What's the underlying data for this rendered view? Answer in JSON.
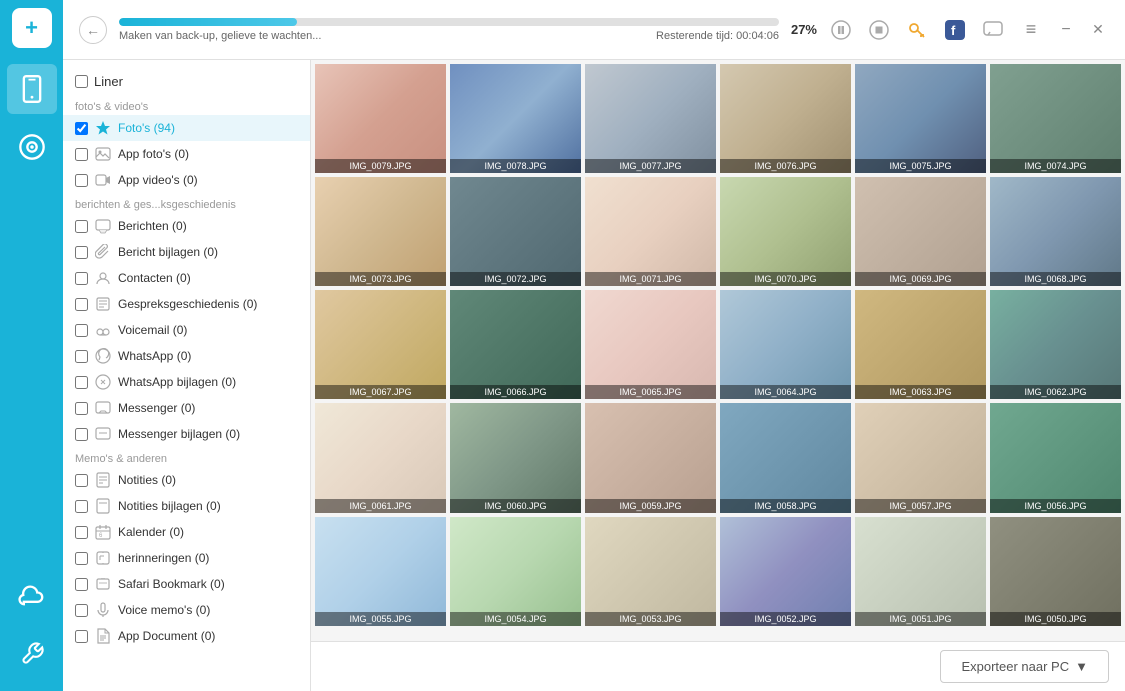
{
  "app": {
    "logo_symbol": "+",
    "accent_color": "#1ab3d8"
  },
  "topbar": {
    "progress_pct": 27,
    "progress_pct_label": "27%",
    "status_text": "Maken van back-up,  gelieve te wachten...",
    "remaining_label": "Resterende tijd: 00:04:06",
    "pause_icon": "⏸",
    "stop_icon": "⏺",
    "key_icon": "🔑",
    "facebook_icon": "f",
    "chat_icon": "💬",
    "menu_icon": "≡",
    "minimize_icon": "−",
    "close_icon": "✕"
  },
  "sidebar_nav": {
    "icons": [
      {
        "name": "phone-icon",
        "symbol": "📱"
      },
      {
        "name": "music-icon",
        "symbol": "🎵"
      },
      {
        "name": "cloud-icon",
        "symbol": "☁"
      },
      {
        "name": "tools-icon",
        "symbol": "🔧"
      }
    ]
  },
  "left_panel": {
    "header_label": "Liner",
    "sections": [
      {
        "label": "foto's & video's",
        "items": [
          {
            "id": "fotos",
            "label": "Foto's (94)",
            "active": true,
            "icon": "star-icon"
          },
          {
            "id": "appfotos",
            "label": "App foto's (0)",
            "active": false,
            "icon": "photo-icon"
          },
          {
            "id": "appvideos",
            "label": "App video's (0)",
            "active": false,
            "icon": "video-icon"
          }
        ]
      },
      {
        "label": "berichten & ges...ksgeschiedenis",
        "items": [
          {
            "id": "berichten",
            "label": "Berichten (0)",
            "active": false,
            "icon": "message-icon"
          },
          {
            "id": "berichtbijlagen",
            "label": "Bericht bijlagen (0)",
            "active": false,
            "icon": "attachment-icon"
          },
          {
            "id": "contacten",
            "label": "Contacten (0)",
            "active": false,
            "icon": "contacts-icon"
          },
          {
            "id": "gesprek",
            "label": "Gespreksgeschiedenis (0)",
            "active": false,
            "icon": "history-icon"
          },
          {
            "id": "voicemail",
            "label": "Voicemail (0)",
            "active": false,
            "icon": "voicemail-icon"
          },
          {
            "id": "whatsapp",
            "label": "WhatsApp (0)",
            "active": false,
            "icon": "whatsapp-icon"
          },
          {
            "id": "whatsappbijlagen",
            "label": "WhatsApp bijlagen (0)",
            "active": false,
            "icon": "whatsapp-attach-icon"
          },
          {
            "id": "messenger",
            "label": "Messenger (0)",
            "active": false,
            "icon": "messenger-icon"
          },
          {
            "id": "messengerbijlagen",
            "label": "Messenger bijlagen (0)",
            "active": false,
            "icon": "messenger-attach-icon"
          }
        ]
      },
      {
        "label": "Memo's & anderen",
        "items": [
          {
            "id": "notities",
            "label": "Notities (0)",
            "active": false,
            "icon": "notes-icon"
          },
          {
            "id": "notitiesbijlagen",
            "label": "Notities bijlagen (0)",
            "active": false,
            "icon": "notes-attach-icon"
          },
          {
            "id": "kalender",
            "label": "Kalender (0)",
            "active": false,
            "icon": "calendar-icon"
          },
          {
            "id": "herinneringen",
            "label": "herinneringen (0)",
            "active": false,
            "icon": "reminder-icon"
          },
          {
            "id": "safari",
            "label": "Safari Bookmark (0)",
            "active": false,
            "icon": "safari-icon"
          },
          {
            "id": "voicememos",
            "label": "Voice memo's (0)",
            "active": false,
            "icon": "voice-memo-icon"
          },
          {
            "id": "appdocument",
            "label": "App Document (0)",
            "active": false,
            "icon": "document-icon"
          }
        ]
      }
    ]
  },
  "photo_grid": {
    "photos": [
      {
        "label": "IMG_0079.JPG",
        "color_class": "c1"
      },
      {
        "label": "IMG_0078.JPG",
        "color_class": "c2"
      },
      {
        "label": "IMG_0077.JPG",
        "color_class": "c3"
      },
      {
        "label": "IMG_0076.JPG",
        "color_class": "c4"
      },
      {
        "label": "IMG_0075.JPG",
        "color_class": "c5"
      },
      {
        "label": "IMG_0074.JPG",
        "color_class": "c6"
      },
      {
        "label": "IMG_0073.JPG",
        "color_class": "c7"
      },
      {
        "label": "IMG_0072.JPG",
        "color_class": "c8"
      },
      {
        "label": "IMG_0071.JPG",
        "color_class": "c9"
      },
      {
        "label": "IMG_0070.JPG",
        "color_class": "c10"
      },
      {
        "label": "IMG_0069.JPG",
        "color_class": "c11"
      },
      {
        "label": "IMG_0068.JPG",
        "color_class": "c12"
      },
      {
        "label": "IMG_0067.JPG",
        "color_class": "c13"
      },
      {
        "label": "IMG_0066.JPG",
        "color_class": "c14"
      },
      {
        "label": "IMG_0065.JPG",
        "color_class": "c15"
      },
      {
        "label": "IMG_0064.JPG",
        "color_class": "c16"
      },
      {
        "label": "IMG_0063.JPG",
        "color_class": "c17"
      },
      {
        "label": "IMG_0062.JPG",
        "color_class": "c18"
      },
      {
        "label": "IMG_0061.JPG",
        "color_class": "c19"
      },
      {
        "label": "IMG_0060.JPG",
        "color_class": "c20"
      },
      {
        "label": "IMG_0059.JPG",
        "color_class": "c21"
      },
      {
        "label": "IMG_0058.JPG",
        "color_class": "c22"
      },
      {
        "label": "IMG_0057.JPG",
        "color_class": "c23"
      },
      {
        "label": "IMG_0056.JPG",
        "color_class": "c24"
      },
      {
        "label": "IMG_0055.JPG",
        "color_class": "c25"
      },
      {
        "label": "IMG_0054.JPG",
        "color_class": "c26"
      },
      {
        "label": "IMG_0053.JPG",
        "color_class": "c27"
      },
      {
        "label": "IMG_0052.JPG",
        "color_class": "c28"
      },
      {
        "label": "IMG_0051.JPG",
        "color_class": "c29"
      },
      {
        "label": "IMG_0050.JPG",
        "color_class": "c30"
      }
    ]
  },
  "bottom_bar": {
    "export_label": "Exporteer naar PC",
    "chevron": "▼"
  }
}
